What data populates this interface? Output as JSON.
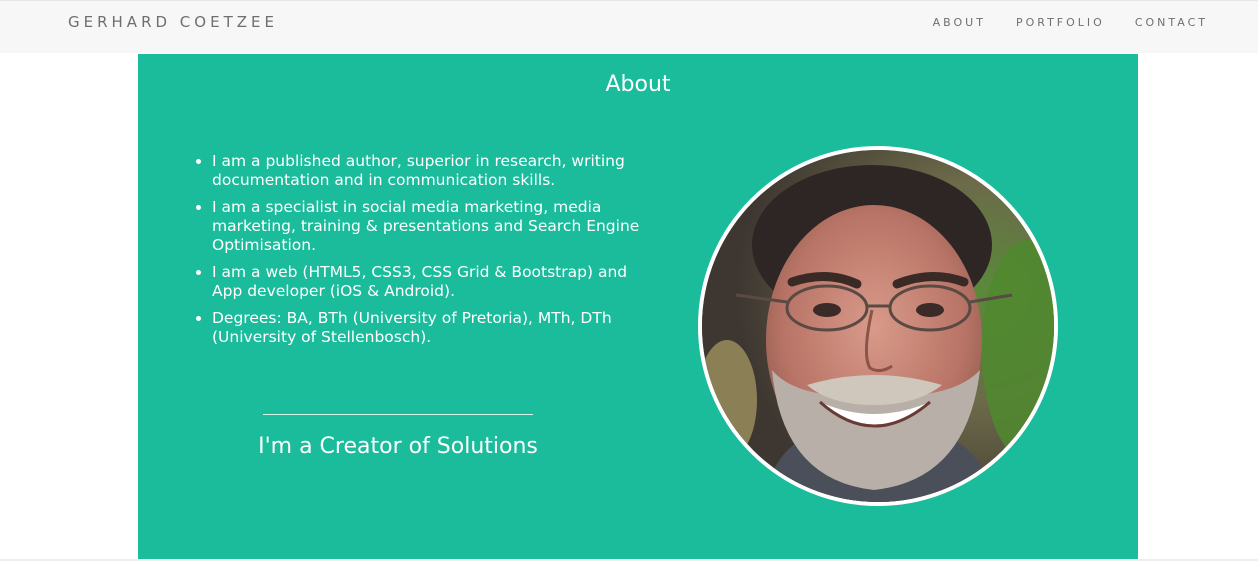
{
  "nav": {
    "brand": "GERHARD COETZEE",
    "links": [
      "ABOUT",
      "PORTFOLIO",
      "CONTACT"
    ]
  },
  "about": {
    "title": "About",
    "items": [
      "I am a published author, superior in research, writing documentation and in communication skills.",
      "I am a specialist in social media marketing, media marketing, training & presentations and Search Engine Optimisation.",
      "I am a web (HTML5, CSS3, CSS Grid & Bootstrap) and App developer (iOS & Android).",
      "Degrees: BA, BTh (University of Pretoria), MTh, DTh (University of Stellenbosch)."
    ],
    "tagline": "I'm a Creator of Solutions",
    "photo": "portrait-photo"
  },
  "colors": {
    "accent": "#1abc9c",
    "navbar_bg": "#f7f7f7",
    "nav_text": "#6f6f6f"
  }
}
